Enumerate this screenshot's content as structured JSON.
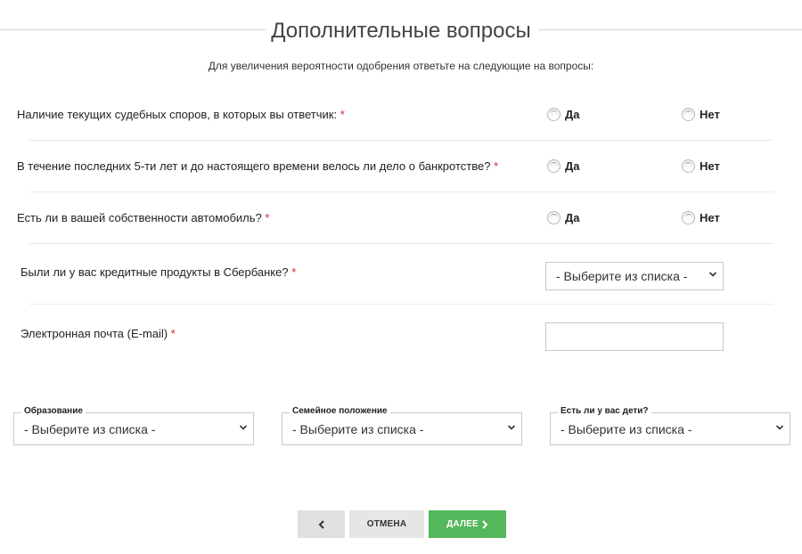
{
  "page": {
    "title": "Дополнительные вопросы",
    "subtitle": "Для увеличения вероятности одобрения ответьте на следующие на вопросы:"
  },
  "questions": [
    {
      "label": "Наличие текущих судебных споров, в которых вы ответчик:",
      "required_mark": "*",
      "yes_label": "Да",
      "no_label": "Нет"
    },
    {
      "label": "В течение последних 5-ти лет и до настоящего времени велось ли дело о банкротстве?",
      "required_mark": "*",
      "yes_label": "Да",
      "no_label": "Нет"
    },
    {
      "label": "Есть ли в вашей собственности автомобиль?",
      "required_mark": "*",
      "yes_label": "Да",
      "no_label": "Нет"
    }
  ],
  "sberbank": {
    "label": "Были ли у вас кредитные продукты в Сбербанке?",
    "required_mark": "*",
    "selected": "- Выберите из списка -"
  },
  "email": {
    "label": "Электронная почта (E-mail)",
    "required_mark": "*",
    "value": ""
  },
  "selects": [
    {
      "label": "Образование",
      "selected": "- Выберите из списка -"
    },
    {
      "label": "Семейное положение",
      "selected": "- Выберите из списка -"
    },
    {
      "label": "Есть ли у вас дети?",
      "selected": "- Выберите из списка -"
    }
  ],
  "buttons": {
    "back_icon": "chevron-left-icon",
    "cancel_label": "ОТМЕНА",
    "next_label": "ДАЛЕЕ",
    "next_icon": "chevron-right-icon"
  },
  "colors": {
    "accent_green": "#55b75c",
    "required_red": "#d9262c",
    "button_gray": "#e0e0e0"
  }
}
